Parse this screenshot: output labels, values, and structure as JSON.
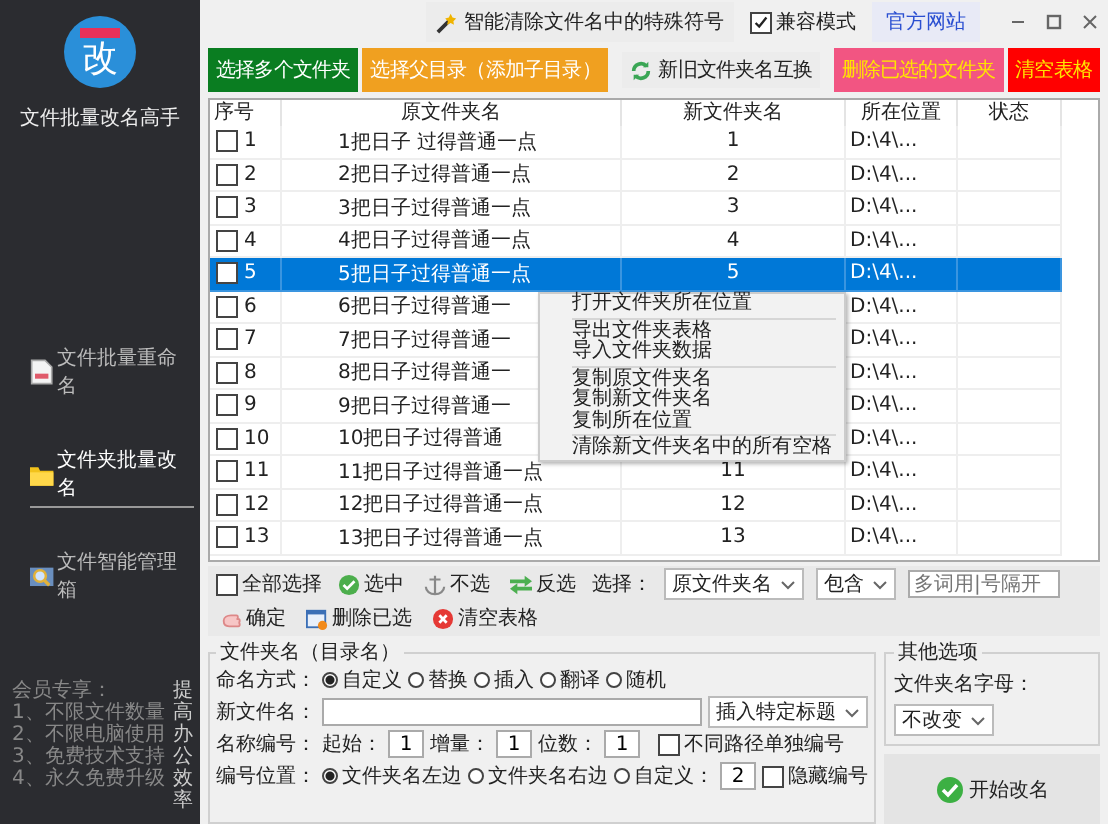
{
  "sidebar": {
    "logo_char": "改",
    "app_title": "文件批量改名高手",
    "nav": [
      {
        "label": "文件批量重命名",
        "selected": false
      },
      {
        "label": "文件夹批量改名",
        "selected": true
      },
      {
        "label": "文件智能管理箱",
        "selected": false
      }
    ],
    "promo": [
      "会员专享：",
      "1、不限文件数量",
      "2、不限电脑使用",
      "3、免费技术支持",
      "4、永久免费升级"
    ],
    "slogan": "提高办公效率"
  },
  "topbar": {
    "clean_button": "智能清除文件名中的特殊符号",
    "compat": {
      "label": "兼容模式",
      "checked": true
    },
    "website": "官方网站"
  },
  "toolbar": [
    {
      "label": "选择多个文件夹",
      "kind": "green"
    },
    {
      "label": "选择父目录（添加子目录）",
      "kind": "orange"
    },
    {
      "label": "新旧文件夹名互换",
      "kind": "swap"
    },
    {
      "label": "删除已选的文件夹",
      "kind": "pink"
    },
    {
      "label": "清空表格",
      "kind": "red"
    }
  ],
  "table": {
    "columns": [
      "序号",
      "原文件夹名",
      "新文件夹名",
      "所在位置",
      "状态"
    ],
    "rows": [
      {
        "no": "1",
        "checked": false,
        "selected": false,
        "original": "1把日子 过得普通一点",
        "new": "1",
        "location": "D:\\4\\..."
      },
      {
        "no": "2",
        "checked": false,
        "selected": false,
        "original": "2把日子过得普通一点",
        "new": "2",
        "location": "D:\\4\\..."
      },
      {
        "no": "3",
        "checked": false,
        "selected": false,
        "original": "3把日子过得普通一点",
        "new": "3",
        "location": "D:\\4\\..."
      },
      {
        "no": "4",
        "checked": false,
        "selected": false,
        "original": "4把日子过得普通一点",
        "new": "4",
        "location": "D:\\4\\..."
      },
      {
        "no": "5",
        "checked": false,
        "selected": true,
        "original": "5把日子过得普通一点",
        "new": "5",
        "location": "D:\\4\\..."
      },
      {
        "no": "6",
        "checked": false,
        "selected": false,
        "original": "6把日子过得普通一",
        "location": "D:\\4\\..."
      },
      {
        "no": "7",
        "checked": false,
        "selected": false,
        "original": "7把日子过得普通一",
        "location": "D:\\4\\..."
      },
      {
        "no": "8",
        "checked": false,
        "selected": false,
        "original": "8把日子过得普通一",
        "location": "D:\\4\\..."
      },
      {
        "no": "9",
        "checked": false,
        "selected": false,
        "original": "9把日子过得普通一",
        "location": "D:\\4\\..."
      },
      {
        "no": "10",
        "checked": false,
        "selected": false,
        "original": "10把日子过得普通",
        "location": "D:\\4\\..."
      },
      {
        "no": "11",
        "checked": false,
        "selected": false,
        "original": "11把日子过得普通一点",
        "new": "11",
        "location": "D:\\4\\..."
      },
      {
        "no": "12",
        "checked": false,
        "selected": false,
        "original": "12把日子过得普通一点",
        "new": "12",
        "location": "D:\\4\\..."
      },
      {
        "no": "13",
        "checked": false,
        "selected": false,
        "original": "13把日子过得普通一点",
        "new": "13",
        "location": "D:\\4\\..."
      }
    ]
  },
  "context_menu": {
    "groups": [
      [
        "打开文件夹所在位置"
      ],
      [
        "导出文件夹表格",
        "导入文件夹数据"
      ],
      [
        "复制原文件夹名",
        "复制新文件夹名",
        "复制所在位置"
      ],
      [
        "清除新文件夹名中的所有空格"
      ]
    ]
  },
  "selection_bar": {
    "select_all": {
      "label": "全部选择",
      "checked": false
    },
    "actions": [
      {
        "label": "选中",
        "kind": "check"
      },
      {
        "label": "不选",
        "kind": "anchor"
      },
      {
        "label": "反选",
        "kind": "invert"
      }
    ],
    "filter_label": "选择：",
    "field": "原文件夹名",
    "match": "包含",
    "keyword_placeholder": "多词用|号隔开",
    "confirm": "确定",
    "delete_selected": "删除已选",
    "clear": "清空表格"
  },
  "rename": {
    "title": "文件夹名（目录名）",
    "mode_label": "命名方式：",
    "modes": [
      {
        "label": "自定义",
        "selected": true
      },
      {
        "label": "替换",
        "selected": false
      },
      {
        "label": "插入",
        "selected": false
      },
      {
        "label": "翻译",
        "selected": false
      },
      {
        "label": "随机",
        "selected": false
      }
    ],
    "newname_label": "新文件名：",
    "insert_dropdown": "插入特定标题",
    "number_label": "名称编号：",
    "start_label": "起始：",
    "start": "1",
    "step_label": "增量：",
    "step": "1",
    "digits_label": "位数：",
    "digits": "1",
    "separate": {
      "label": "不同路径单独编号",
      "checked": false
    },
    "position_label": "编号位置：",
    "positions": [
      {
        "label": "文件夹名左边",
        "selected": true
      },
      {
        "label": "文件夹名右边",
        "selected": false
      },
      {
        "label": "自定义：",
        "selected": false
      }
    ],
    "custom_value": "2",
    "hide": {
      "label": "隐藏编号",
      "checked": false
    }
  },
  "other_options": {
    "title": "其他选项",
    "letter_label": "文件夹名字母：",
    "letter_value": "不改变"
  },
  "start_button": "开始改名"
}
